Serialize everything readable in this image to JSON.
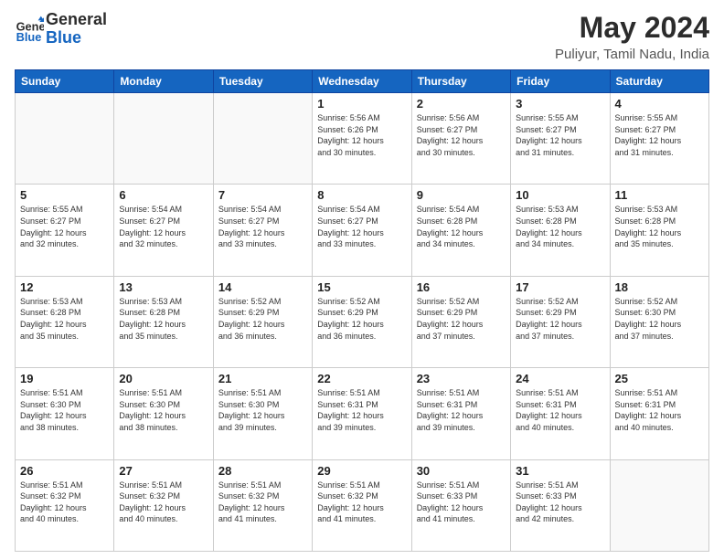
{
  "header": {
    "logo_line1": "General",
    "logo_line2": "Blue",
    "title": "May 2024",
    "subtitle": "Puliyur, Tamil Nadu, India"
  },
  "weekdays": [
    "Sunday",
    "Monday",
    "Tuesday",
    "Wednesday",
    "Thursday",
    "Friday",
    "Saturday"
  ],
  "weeks": [
    [
      {
        "day": "",
        "info": ""
      },
      {
        "day": "",
        "info": ""
      },
      {
        "day": "",
        "info": ""
      },
      {
        "day": "1",
        "info": "Sunrise: 5:56 AM\nSunset: 6:26 PM\nDaylight: 12 hours\nand 30 minutes."
      },
      {
        "day": "2",
        "info": "Sunrise: 5:56 AM\nSunset: 6:27 PM\nDaylight: 12 hours\nand 30 minutes."
      },
      {
        "day": "3",
        "info": "Sunrise: 5:55 AM\nSunset: 6:27 PM\nDaylight: 12 hours\nand 31 minutes."
      },
      {
        "day": "4",
        "info": "Sunrise: 5:55 AM\nSunset: 6:27 PM\nDaylight: 12 hours\nand 31 minutes."
      }
    ],
    [
      {
        "day": "5",
        "info": "Sunrise: 5:55 AM\nSunset: 6:27 PM\nDaylight: 12 hours\nand 32 minutes."
      },
      {
        "day": "6",
        "info": "Sunrise: 5:54 AM\nSunset: 6:27 PM\nDaylight: 12 hours\nand 32 minutes."
      },
      {
        "day": "7",
        "info": "Sunrise: 5:54 AM\nSunset: 6:27 PM\nDaylight: 12 hours\nand 33 minutes."
      },
      {
        "day": "8",
        "info": "Sunrise: 5:54 AM\nSunset: 6:27 PM\nDaylight: 12 hours\nand 33 minutes."
      },
      {
        "day": "9",
        "info": "Sunrise: 5:54 AM\nSunset: 6:28 PM\nDaylight: 12 hours\nand 34 minutes."
      },
      {
        "day": "10",
        "info": "Sunrise: 5:53 AM\nSunset: 6:28 PM\nDaylight: 12 hours\nand 34 minutes."
      },
      {
        "day": "11",
        "info": "Sunrise: 5:53 AM\nSunset: 6:28 PM\nDaylight: 12 hours\nand 35 minutes."
      }
    ],
    [
      {
        "day": "12",
        "info": "Sunrise: 5:53 AM\nSunset: 6:28 PM\nDaylight: 12 hours\nand 35 minutes."
      },
      {
        "day": "13",
        "info": "Sunrise: 5:53 AM\nSunset: 6:28 PM\nDaylight: 12 hours\nand 35 minutes."
      },
      {
        "day": "14",
        "info": "Sunrise: 5:52 AM\nSunset: 6:29 PM\nDaylight: 12 hours\nand 36 minutes."
      },
      {
        "day": "15",
        "info": "Sunrise: 5:52 AM\nSunset: 6:29 PM\nDaylight: 12 hours\nand 36 minutes."
      },
      {
        "day": "16",
        "info": "Sunrise: 5:52 AM\nSunset: 6:29 PM\nDaylight: 12 hours\nand 37 minutes."
      },
      {
        "day": "17",
        "info": "Sunrise: 5:52 AM\nSunset: 6:29 PM\nDaylight: 12 hours\nand 37 minutes."
      },
      {
        "day": "18",
        "info": "Sunrise: 5:52 AM\nSunset: 6:30 PM\nDaylight: 12 hours\nand 37 minutes."
      }
    ],
    [
      {
        "day": "19",
        "info": "Sunrise: 5:51 AM\nSunset: 6:30 PM\nDaylight: 12 hours\nand 38 minutes."
      },
      {
        "day": "20",
        "info": "Sunrise: 5:51 AM\nSunset: 6:30 PM\nDaylight: 12 hours\nand 38 minutes."
      },
      {
        "day": "21",
        "info": "Sunrise: 5:51 AM\nSunset: 6:30 PM\nDaylight: 12 hours\nand 39 minutes."
      },
      {
        "day": "22",
        "info": "Sunrise: 5:51 AM\nSunset: 6:31 PM\nDaylight: 12 hours\nand 39 minutes."
      },
      {
        "day": "23",
        "info": "Sunrise: 5:51 AM\nSunset: 6:31 PM\nDaylight: 12 hours\nand 39 minutes."
      },
      {
        "day": "24",
        "info": "Sunrise: 5:51 AM\nSunset: 6:31 PM\nDaylight: 12 hours\nand 40 minutes."
      },
      {
        "day": "25",
        "info": "Sunrise: 5:51 AM\nSunset: 6:31 PM\nDaylight: 12 hours\nand 40 minutes."
      }
    ],
    [
      {
        "day": "26",
        "info": "Sunrise: 5:51 AM\nSunset: 6:32 PM\nDaylight: 12 hours\nand 40 minutes."
      },
      {
        "day": "27",
        "info": "Sunrise: 5:51 AM\nSunset: 6:32 PM\nDaylight: 12 hours\nand 40 minutes."
      },
      {
        "day": "28",
        "info": "Sunrise: 5:51 AM\nSunset: 6:32 PM\nDaylight: 12 hours\nand 41 minutes."
      },
      {
        "day": "29",
        "info": "Sunrise: 5:51 AM\nSunset: 6:32 PM\nDaylight: 12 hours\nand 41 minutes."
      },
      {
        "day": "30",
        "info": "Sunrise: 5:51 AM\nSunset: 6:33 PM\nDaylight: 12 hours\nand 41 minutes."
      },
      {
        "day": "31",
        "info": "Sunrise: 5:51 AM\nSunset: 6:33 PM\nDaylight: 12 hours\nand 42 minutes."
      },
      {
        "day": "",
        "info": ""
      }
    ]
  ]
}
